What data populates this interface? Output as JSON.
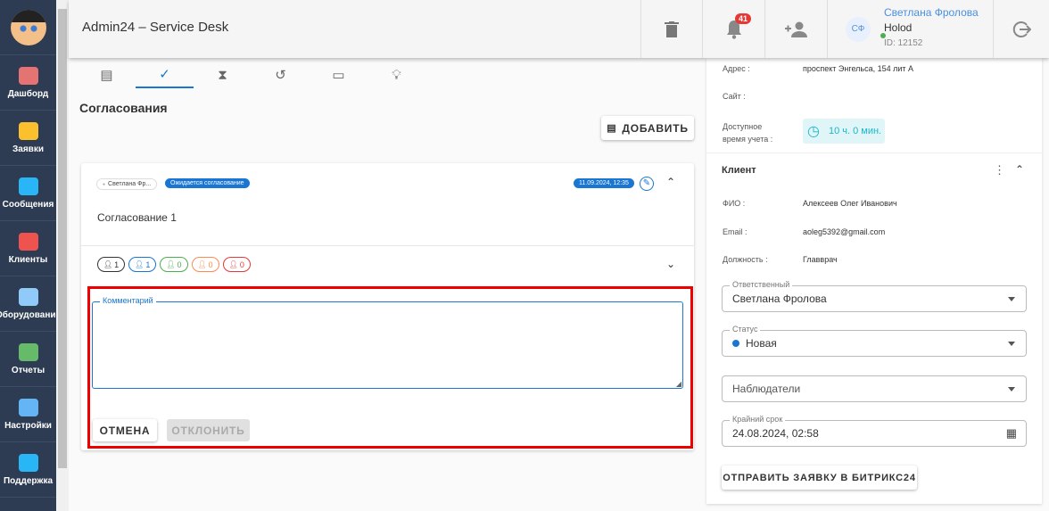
{
  "sidebar": {
    "items": [
      {
        "label": "Дашборд",
        "color": "#e57373"
      },
      {
        "label": "Заявки",
        "color": "#fbc02d"
      },
      {
        "label": "Сообщения",
        "color": "#29b6f6"
      },
      {
        "label": "Клиенты",
        "color": "#ef5350"
      },
      {
        "label": "Оборудование",
        "color": "#90caf9"
      },
      {
        "label": "Отчеты",
        "color": "#66bb6a"
      },
      {
        "label": "Настройки",
        "color": "#64b5f6"
      },
      {
        "label": "Поддержка",
        "color": "#29b6f6"
      }
    ]
  },
  "header": {
    "title": "Admin24 – Service Desk",
    "notifications": "41",
    "user": {
      "initials": "СФ",
      "name": "Светлана Фролова",
      "company": "Holod",
      "id": "ID: 12152"
    }
  },
  "main": {
    "section_title": "Согласования",
    "add_label": "ДОБАВИТЬ",
    "card": {
      "author": "Светлана Фр...",
      "status": "Ожидается согласование",
      "date": "11.09.2024, 12:35",
      "title": "Согласование 1",
      "counters": [
        {
          "value": "1",
          "color": "#333"
        },
        {
          "value": "1",
          "color": "#1976d2"
        },
        {
          "value": "0",
          "color": "#4caf50"
        },
        {
          "value": "0",
          "color": "#ff8a50"
        },
        {
          "value": "0",
          "color": "#e53935"
        }
      ],
      "comment_label": "Комментарий",
      "comment_value": "",
      "cancel_label": "ОТМЕНА",
      "reject_label": "ОТКЛОНИТЬ"
    }
  },
  "right": {
    "address_label": "Адрес :",
    "address": "проспект Энгельса, 154 лит А",
    "site_label": "Сайт :",
    "time_label_1": "Доступное",
    "time_label_2": "время учета :",
    "time_value": "10 ч. 0 мин.",
    "client_title": "Клиент",
    "fio_label": "ФИО :",
    "fio": "Алексеев Олег Иванович",
    "email_label": "Email :",
    "email": "aoleg5392@gmail.com",
    "position_label": "Должность :",
    "position": "Главврач",
    "responsible_label": "Ответственный",
    "responsible": "Светлана Фролова",
    "status_label": "Статус",
    "status": "Новая",
    "observers_placeholder": "Наблюдатели",
    "deadline_label": "Крайний срок",
    "deadline": "24.08.2024, 02:58",
    "bitrix_label": "ОТПРАВИТЬ ЗАЯВКУ В БИТРИКС24"
  }
}
